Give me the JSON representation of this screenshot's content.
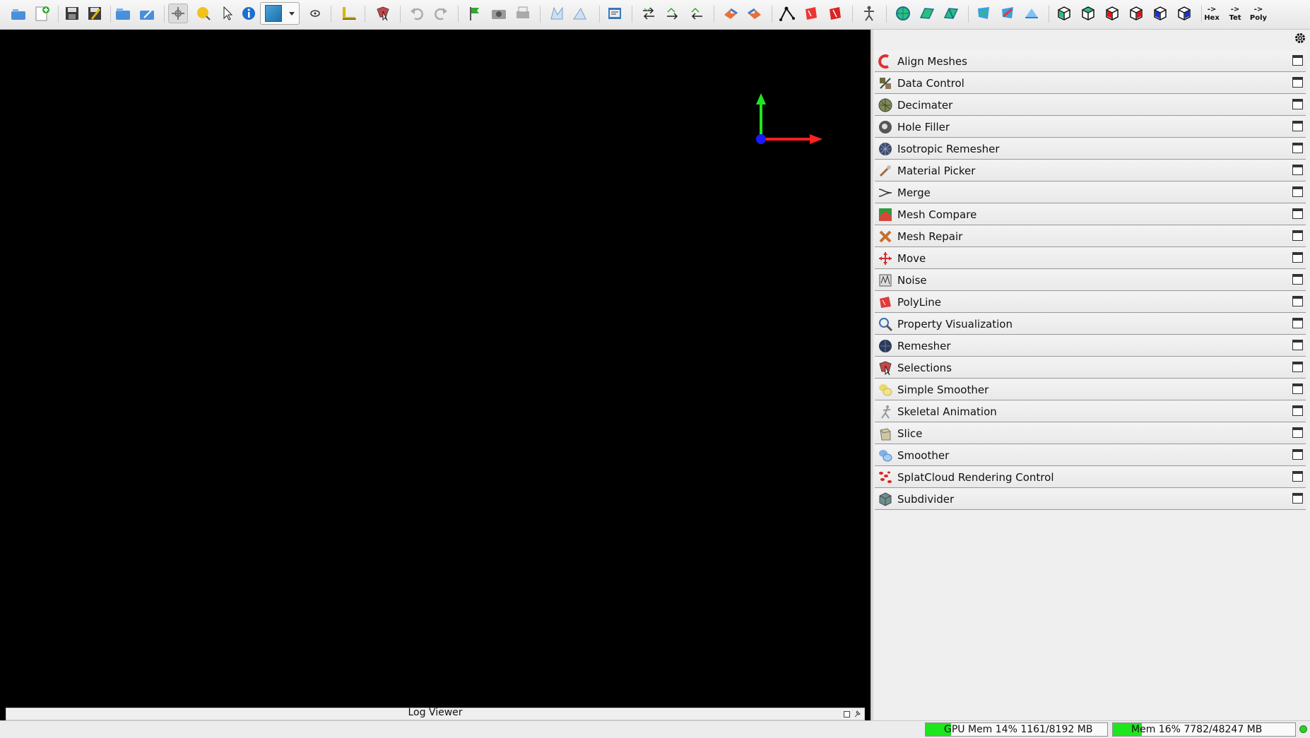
{
  "toolbar": {
    "buttons": [
      {
        "name": "load-object-icon",
        "interactable": true
      },
      {
        "name": "add-empty-object-icon",
        "interactable": true
      },
      {
        "name": "save-icon",
        "interactable": true
      },
      {
        "name": "save-as-icon",
        "interactable": true
      },
      {
        "name": "load-settings-icon",
        "interactable": true
      },
      {
        "name": "save-settings-icon",
        "interactable": true
      },
      {
        "name": "move-mode-icon",
        "interactable": true
      },
      {
        "name": "light-mode-icon",
        "interactable": true
      },
      {
        "name": "picking-cursor-icon",
        "interactable": true
      },
      {
        "name": "info-icon",
        "interactable": true
      },
      {
        "name": "draw-mode-combo",
        "interactable": true
      },
      {
        "name": "stereo-eye-icon",
        "interactable": true
      },
      {
        "name": "measure-ruler-icon",
        "interactable": true
      },
      {
        "name": "selection-cursor-icon",
        "interactable": true
      },
      {
        "name": "undo-icon",
        "interactable": true
      },
      {
        "name": "redo-icon",
        "interactable": true
      },
      {
        "name": "flag-icon",
        "interactable": true
      },
      {
        "name": "snapshot-camera-icon",
        "interactable": true
      },
      {
        "name": "print-icon",
        "interactable": true
      },
      {
        "name": "mesh-icon",
        "interactable": true
      },
      {
        "name": "triangle-icon",
        "interactable": true
      },
      {
        "name": "scripting-icon",
        "interactable": true
      },
      {
        "name": "swap-icon",
        "interactable": true
      },
      {
        "name": "forward-icon",
        "interactable": true
      },
      {
        "name": "backward-icon",
        "interactable": true
      },
      {
        "name": "flip-left-icon",
        "interactable": true
      },
      {
        "name": "flip-right-icon",
        "interactable": true
      },
      {
        "name": "polyline-vertex-icon",
        "interactable": true
      },
      {
        "name": "polyline-red-icon",
        "interactable": true
      },
      {
        "name": "polyline-red2-icon",
        "interactable": true
      },
      {
        "name": "skeleton-icon",
        "interactable": true
      },
      {
        "name": "sphere-green-icon",
        "interactable": true
      },
      {
        "name": "plane-green-icon",
        "interactable": true
      },
      {
        "name": "plane-green2-icon",
        "interactable": true
      },
      {
        "name": "cut-blue-icon",
        "interactable": true
      },
      {
        "name": "cut-blue2-icon",
        "interactable": true
      },
      {
        "name": "triangle-blue-icon",
        "interactable": true
      },
      {
        "name": "cube-green-icon",
        "interactable": true
      },
      {
        "name": "cube-green2-icon",
        "interactable": true
      },
      {
        "name": "cube-red-icon",
        "interactable": true
      },
      {
        "name": "cube-red2-icon",
        "interactable": true
      },
      {
        "name": "cube-blue-icon",
        "interactable": true
      },
      {
        "name": "cube-blue2-icon",
        "interactable": true
      }
    ],
    "convert": [
      {
        "arrow": "->",
        "label": "Hex"
      },
      {
        "arrow": "->",
        "label": "Tet"
      },
      {
        "arrow": "->",
        "label": "Poly"
      }
    ]
  },
  "log_viewer": {
    "title": "Log Viewer"
  },
  "plugins": [
    {
      "label": "Align Meshes",
      "icon": "align-meshes-icon"
    },
    {
      "label": "Data Control",
      "icon": "data-control-icon"
    },
    {
      "label": "Decimater",
      "icon": "decimater-icon"
    },
    {
      "label": "Hole Filler",
      "icon": "hole-filler-icon"
    },
    {
      "label": "Isotropic Remesher",
      "icon": "isotropic-remesher-icon"
    },
    {
      "label": "Material Picker",
      "icon": "material-picker-icon"
    },
    {
      "label": "Merge",
      "icon": "merge-icon"
    },
    {
      "label": "Mesh Compare",
      "icon": "mesh-compare-icon"
    },
    {
      "label": "Mesh Repair",
      "icon": "mesh-repair-icon"
    },
    {
      "label": "Move",
      "icon": "move-icon"
    },
    {
      "label": "Noise",
      "icon": "noise-icon"
    },
    {
      "label": "PolyLine",
      "icon": "polyline-icon"
    },
    {
      "label": "Property Visualization",
      "icon": "property-visualization-icon"
    },
    {
      "label": "Remesher",
      "icon": "remesher-icon"
    },
    {
      "label": "Selections",
      "icon": "selections-icon"
    },
    {
      "label": "Simple Smoother",
      "icon": "simple-smoother-icon"
    },
    {
      "label": "Skeletal Animation",
      "icon": "skeletal-animation-icon"
    },
    {
      "label": "Slice",
      "icon": "slice-icon"
    },
    {
      "label": "Smoother",
      "icon": "smoother-icon"
    },
    {
      "label": "SplatCloud Rendering Control",
      "icon": "splatcloud-icon"
    },
    {
      "label": "Subdivider",
      "icon": "subdivider-icon"
    }
  ],
  "status": {
    "gpu_mem": "GPU Mem 14% 1161/8192 MB",
    "gpu_fraction": 0.14,
    "mem": "Mem 16% 7782/48247 MB",
    "mem_fraction": 0.16
  },
  "colors": {
    "viewport_bg": "#000000",
    "axis_x": "#ff2020",
    "axis_y": "#1ee51e",
    "axis_origin": "#1a1aff",
    "mem_fill": "#1ee51e"
  }
}
